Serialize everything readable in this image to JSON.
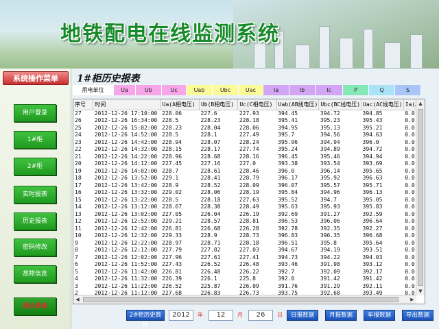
{
  "app": {
    "title": "地铁配电在线监测系统"
  },
  "menu": {
    "title": "系统操作菜单",
    "items": [
      {
        "label": "用户登录"
      },
      {
        "label": "1#柜"
      },
      {
        "label": "2#柜"
      },
      {
        "label": "实时报表"
      },
      {
        "label": "历史报表"
      },
      {
        "label": "密码修改"
      },
      {
        "label": "故障信息"
      },
      {
        "label": "退出系统"
      }
    ]
  },
  "report": {
    "title": "1#柜历史报表"
  },
  "phase_bar": [
    {
      "label": "用电单位",
      "color": "#ffffff"
    },
    {
      "label": "Ua",
      "color": "#f7a6e8"
    },
    {
      "label": "Ub",
      "color": "#f7a6e8"
    },
    {
      "label": "Uc",
      "color": "#f7a6e8"
    },
    {
      "label": "Uab",
      "color": "#fbfb9a"
    },
    {
      "label": "Ubc",
      "color": "#fbfb9a"
    },
    {
      "label": "Uac",
      "color": "#fbfb9a"
    },
    {
      "label": "Ia",
      "color": "#d2a6f5"
    },
    {
      "label": "Ib",
      "color": "#d2a6f5"
    },
    {
      "label": "Ic",
      "color": "#d2a6f5"
    },
    {
      "label": "P",
      "color": "#86e8b6"
    },
    {
      "label": "Q",
      "color": "#a9e3f7"
    },
    {
      "label": "S",
      "color": "#a9c4f7"
    }
  ],
  "table": {
    "columns": [
      "序号",
      "时间",
      "Ua(A相电压)",
      "Ub(B相电压)",
      "Uc(C相电压)",
      "Uab(AB线电压)",
      "Ubc(BC线电压)",
      "Uac(AC线电压)",
      "Ia(A相"
    ],
    "rows": [
      [
        "27",
        "2012-12-26 17:10:00",
        "228.06",
        "227.6",
        "227.93",
        "394.45",
        "394.72",
        "394.85",
        "0.0"
      ],
      [
        "26",
        "2012-12-26 16:34:00",
        "228.5",
        "228.23",
        "228.18",
        "395.41",
        "395.23",
        "395.43",
        "0.0"
      ],
      [
        "25",
        "2012-12-26 15:02:00",
        "228.23",
        "228.04",
        "228.06",
        "394.95",
        "395.13",
        "395.21",
        "0.0"
      ],
      [
        "24",
        "2012-12-26 14:52:00",
        "228.5",
        "228.1",
        "227.49",
        "395.7",
        "394.56",
        "394.63",
        "0.0"
      ],
      [
        "23",
        "2012-12-26 14:42:00",
        "228.94",
        "228.07",
        "228.24",
        "395.96",
        "394.94",
        "396.0",
        "0.0"
      ],
      [
        "22",
        "2012-12-26 14:32:00",
        "228.15",
        "228.17",
        "227.74",
        "395.24",
        "394.89",
        "394.72",
        "0.0"
      ],
      [
        "21",
        "2012-12-26 14:22:00",
        "228.96",
        "228.68",
        "228.16",
        "396.45",
        "395.46",
        "394.94",
        "0.0"
      ],
      [
        "20",
        "2012-12-26 14:12:00",
        "227.45",
        "227.16",
        "227.0",
        "393.38",
        "393.54",
        "393.69",
        "0.0"
      ],
      [
        "19",
        "2012-12-26 14:02:00",
        "228.7",
        "228.61",
        "228.46",
        "396.0",
        "396.14",
        "395.65",
        "0.0"
      ],
      [
        "18",
        "2012-12-26 13:52:00",
        "229.1",
        "228.41",
        "228.79",
        "396.17",
        "395.92",
        "396.63",
        "0.0"
      ],
      [
        "17",
        "2012-12-26 13:42:00",
        "228.9",
        "228.52",
        "228.09",
        "396.07",
        "395.57",
        "395.71",
        "0.0"
      ],
      [
        "16",
        "2012-12-26 13:32:00",
        "229.02",
        "228.06",
        "228.19",
        "395.84",
        "394.96",
        "396.13",
        "0.0"
      ],
      [
        "15",
        "2012-12-26 13:22:00",
        "228.5",
        "228.18",
        "227.63",
        "395.52",
        "394.7",
        "395.05",
        "0.0"
      ],
      [
        "14",
        "2012-12-26 13:12:00",
        "228.67",
        "228.38",
        "228.49",
        "395.63",
        "395.93",
        "395.83",
        "0.0"
      ],
      [
        "13",
        "2012-12-26 13:02:00",
        "227.05",
        "226.04",
        "226.19",
        "392.69",
        "391.27",
        "392.59",
        "0.0"
      ],
      [
        "12",
        "2012-12-26 12:52:00",
        "229.21",
        "228.57",
        "228.81",
        "396.53",
        "396.06",
        "396.64",
        "0.0"
      ],
      [
        "11",
        "2012-12-26 12:42:00",
        "226.81",
        "226.68",
        "226.28",
        "392.78",
        "392.35",
        "392.27",
        "0.0"
      ],
      [
        "10",
        "2012-12-26 12:32:00",
        "229.33",
        "228.9",
        "228.73",
        "396.83",
        "396.35",
        "396.68",
        "0.0"
      ],
      [
        "9",
        "2012-12-26 12:22:00",
        "228.97",
        "228.71",
        "228.18",
        "396.51",
        "395.8",
        "395.64",
        "0.0"
      ],
      [
        "8",
        "2012-12-26 12:12:00",
        "227.79",
        "227.82",
        "227.03",
        "394.67",
        "394.19",
        "393.51",
        "0.0"
      ],
      [
        "7",
        "2012-12-26 12:02:00",
        "227.96",
        "227.61",
        "227.41",
        "394.73",
        "394.22",
        "394.03",
        "0.0"
      ],
      [
        "6",
        "2012-12-26 11:52:00",
        "227.43",
        "226.52",
        "226.48",
        "393.46",
        "391.98",
        "393.12",
        "0.0"
      ],
      [
        "5",
        "2012-12-26 11:42:00",
        "226.81",
        "226.48",
        "226.22",
        "392.7",
        "392.09",
        "392.17",
        "0.0"
      ],
      [
        "4",
        "2012-12-26 11:32:00",
        "226.39",
        "226.1",
        "225.8",
        "392.0",
        "391.42",
        "391.42",
        "0.0"
      ],
      [
        "3",
        "2012-12-26 11:22:00",
        "226.52",
        "225.87",
        "226.09",
        "391.76",
        "391.29",
        "392.11",
        "0.0"
      ],
      [
        "2",
        "2012-12-26 11:12:00",
        "227.68",
        "226.83",
        "226.73",
        "393.75",
        "392.68",
        "393.49",
        "0.0"
      ],
      [
        "1",
        "2012-12-26 11:02:00",
        "226.42",
        "226.35",
        "226.25",
        "392.09",
        "392.04",
        "391.81",
        "0.0"
      ]
    ]
  },
  "toolbar": {
    "history_button": "2#柜历史数据",
    "year_value": "2012",
    "year_label": "年",
    "month_value": "12",
    "month_label": "月",
    "day_value": "26",
    "day_label": "日",
    "daily_button": "日报数据",
    "monthly_button": "月报数据",
    "yearly_button": "年报数据",
    "export_button": "导出数据"
  }
}
